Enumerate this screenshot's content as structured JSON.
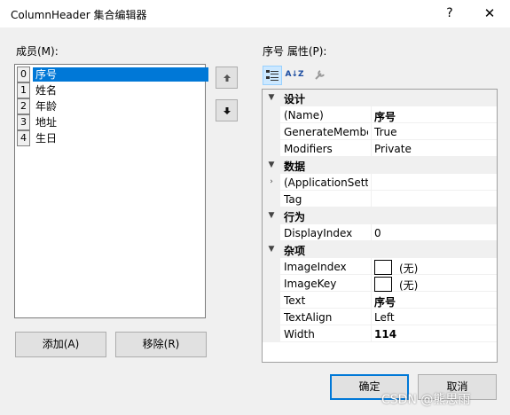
{
  "window": {
    "title": "ColumnHeader 集合编辑器",
    "help_label": "?",
    "close_label": "✕"
  },
  "members": {
    "label": "成员(M):",
    "items": [
      {
        "index": "0",
        "name": "序号",
        "selected": true
      },
      {
        "index": "1",
        "name": "姓名",
        "selected": false
      },
      {
        "index": "2",
        "name": "年龄",
        "selected": false
      },
      {
        "index": "3",
        "name": "地址",
        "selected": false
      },
      {
        "index": "4",
        "name": "生日",
        "selected": false
      }
    ],
    "add_label": "添加(A)",
    "remove_label": "移除(R)",
    "move_up_icon": "arrow-up-icon",
    "move_down_icon": "arrow-down-icon"
  },
  "properties": {
    "label": "序号 属性(P):",
    "toolbar": {
      "categorized_icon": "categorized-icon",
      "alphabetical_label": "A↓Z",
      "property_pages_icon": "wrench-icon"
    },
    "categories": [
      {
        "name": "设计",
        "rows": [
          {
            "name": "(Name)",
            "value": "序号",
            "bold": true
          },
          {
            "name": "GenerateMember",
            "value": "True",
            "bold": false
          },
          {
            "name": "Modifiers",
            "value": "Private",
            "bold": false
          }
        ]
      },
      {
        "name": "数据",
        "rows": [
          {
            "name": "(ApplicationSettings)",
            "value": "",
            "bold": false,
            "expandable": true
          },
          {
            "name": "Tag",
            "value": "",
            "bold": false
          }
        ]
      },
      {
        "name": "行为",
        "rows": [
          {
            "name": "DisplayIndex",
            "value": "0",
            "bold": false
          }
        ]
      },
      {
        "name": "杂项",
        "rows": [
          {
            "name": "ImageIndex",
            "value": "(无)",
            "bold": false,
            "swatch": true
          },
          {
            "name": "ImageKey",
            "value": "(无)",
            "bold": false,
            "swatch": true
          },
          {
            "name": "Text",
            "value": "序号",
            "bold": true
          },
          {
            "name": "TextAlign",
            "value": "Left",
            "bold": false
          },
          {
            "name": "Width",
            "value": "114",
            "bold": true
          }
        ]
      }
    ]
  },
  "footer": {
    "ok_label": "确定",
    "cancel_label": "取消",
    "watermark": "CSDN @熊思雨"
  }
}
